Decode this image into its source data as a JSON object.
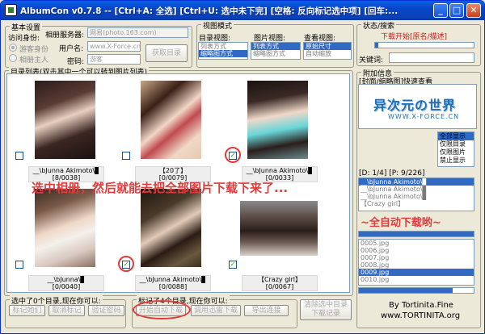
{
  "window": {
    "title": "AlbumCon v0.7.8 -- [Ctrl+A: 全选] [Ctrl+U: 选中未下完] [空格: 反向标记选中项] [回车:...",
    "min": "_",
    "max": "□",
    "close": "✕"
  },
  "basic": {
    "title": "基本设置",
    "access_label": "访问身份:",
    "radio_guest": "游客身份",
    "radio_owner": "相册主人",
    "server_label": "相册服务器:",
    "server_value": "网易(photo.163.com)",
    "user_label": "用户名:",
    "user_value": "www.X-Force.cn",
    "pass_label": "密码:",
    "pass_value": "游客",
    "fetch_button": "获取目录"
  },
  "view": {
    "title": "视图模式",
    "dir_label": "目录视图:",
    "dir_items": [
      "列表方式",
      "缩略图方式"
    ],
    "pic_label": "图片视图:",
    "pic_items": [
      "列表方式",
      "缩略图方式"
    ],
    "look_label": "查看视图:",
    "look_items": [
      "原始尺寸",
      "自动缩放"
    ]
  },
  "state": {
    "title": "状态/搜索",
    "status_text": "下载开始[原名/描述]",
    "keyword_label": "关键词:"
  },
  "dirlist": {
    "title": "目录列表(双击其中一个可以转到图片列表)",
    "items": [
      {
        "caption1": "__\\bJunna Akimoto\\▊",
        "caption2": "[8/0038]",
        "checked": false
      },
      {
        "caption1": "【20了】",
        "caption2": "[0/0079]",
        "checked": false
      },
      {
        "caption1": "__\\bJunna Akimoto\\▊",
        "caption2": "[0/0033]",
        "checked": true
      },
      {
        "caption1": "__\\bJunna\\▊",
        "caption2": "[0/0040]",
        "checked": false
      },
      {
        "caption1": "__\\bJunna Akimoto\\▊",
        "caption2": "[0/0088]",
        "checked": true
      },
      {
        "caption1": "【Crazy girl】",
        "caption2": "[0/0067]",
        "checked": true
      }
    ],
    "check_mark": "✓"
  },
  "annotations": {
    "note_main": "选中相册，然后就能去把全部图片下载下来了...",
    "note_auto": "~全自动下载哟~"
  },
  "extra": {
    "title": "附加信息",
    "preview_label": "[封面/缩略图]快速查看",
    "logo_main": "异次元の世界",
    "logo_sub": "WWW.X-FORCE.CN",
    "modes": [
      "全部显示",
      "仅限目录",
      "仅限图片",
      "禁止显示"
    ],
    "dp_label": "[D: 1/4] [P: 9/226]",
    "dir_rows": [
      "__\\bJunna Akimoto\\▊",
      "__\\bJunna Akimoto\\▊",
      "__\\bJunna Akimoto\\▊",
      "【Crazy girl】"
    ],
    "file_rows": [
      "0005.jpg",
      "0006.jpg",
      "0007.jpg",
      "0008.jpg",
      "0009.jpg",
      "0010.jpg"
    ],
    "selected_file_index": 4,
    "progress": 1.0,
    "progress2": 0.82
  },
  "bottom": {
    "sel_dir_title": "选中了0个目录,现在你可以:",
    "mark_done": "标记她们",
    "cancel_mark": "取消标记",
    "verify_pass": "验证密码",
    "mark_dir_title": "标记了4个目录,现在你可以:",
    "start_download": "开始自动下载",
    "thunder": "调用迅雷下载",
    "export": "导出连接",
    "clear_record1": "清除选中目录",
    "clear_record2": "下载记录",
    "by_line": "By Tortinita.Fine",
    "site_line": "www.TORTINITA.org"
  }
}
